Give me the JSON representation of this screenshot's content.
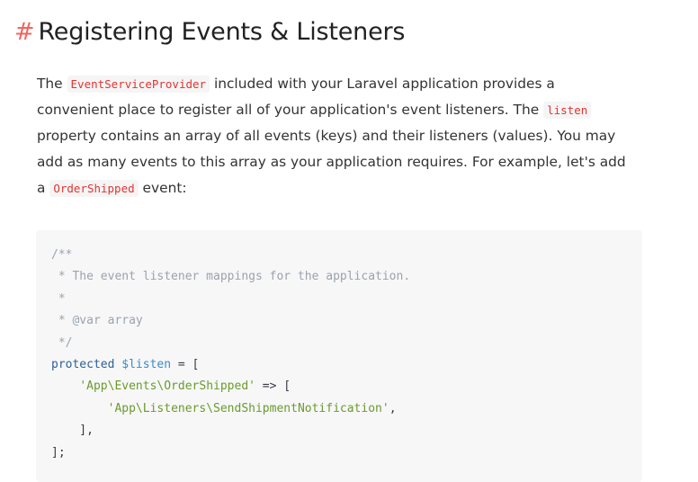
{
  "heading": {
    "hash": "#",
    "title": "Registering Events & Listeners"
  },
  "paragraph": {
    "line1_pre": "The ",
    "line1_code": "EventServiceProvider",
    "line1_post": " included with your Laravel application provides a",
    "line2_pre": "convenient place to register all of your application's event listeners. The ",
    "line2_code": "listen",
    "line3": "property contains an array of all events (keys) and their listeners (values). You may",
    "line4": "add as many events to this array as your application requires. For example, let's add",
    "line5_pre": "a ",
    "line5_code": "OrderShipped",
    "line5_post": " event:"
  },
  "code": {
    "l1": "/**",
    "l2": " * The event listener mappings for the application.",
    "l3": " *",
    "l4": " * @var array",
    "l5": " */",
    "l6_keyword": "protected",
    "l6_var": "$listen",
    "l6_rest": " = [",
    "l7_indent": "    ",
    "l7_string": "'App\\Events\\OrderShipped'",
    "l7_rest": " => [",
    "l8_indent": "        ",
    "l8_string": "'App\\Listeners\\SendShipmentNotification'",
    "l8_rest": ",",
    "l9": "    ],",
    "l10": "];"
  },
  "colors": {
    "hash_accent": "#f4645f",
    "inline_code": "#e3342f",
    "code_background": "#f7f7f8",
    "comment": "#9aa3ad",
    "keyword": "#2e5f95",
    "variable": "#3a8cc4",
    "string": "#6a9b2c"
  }
}
